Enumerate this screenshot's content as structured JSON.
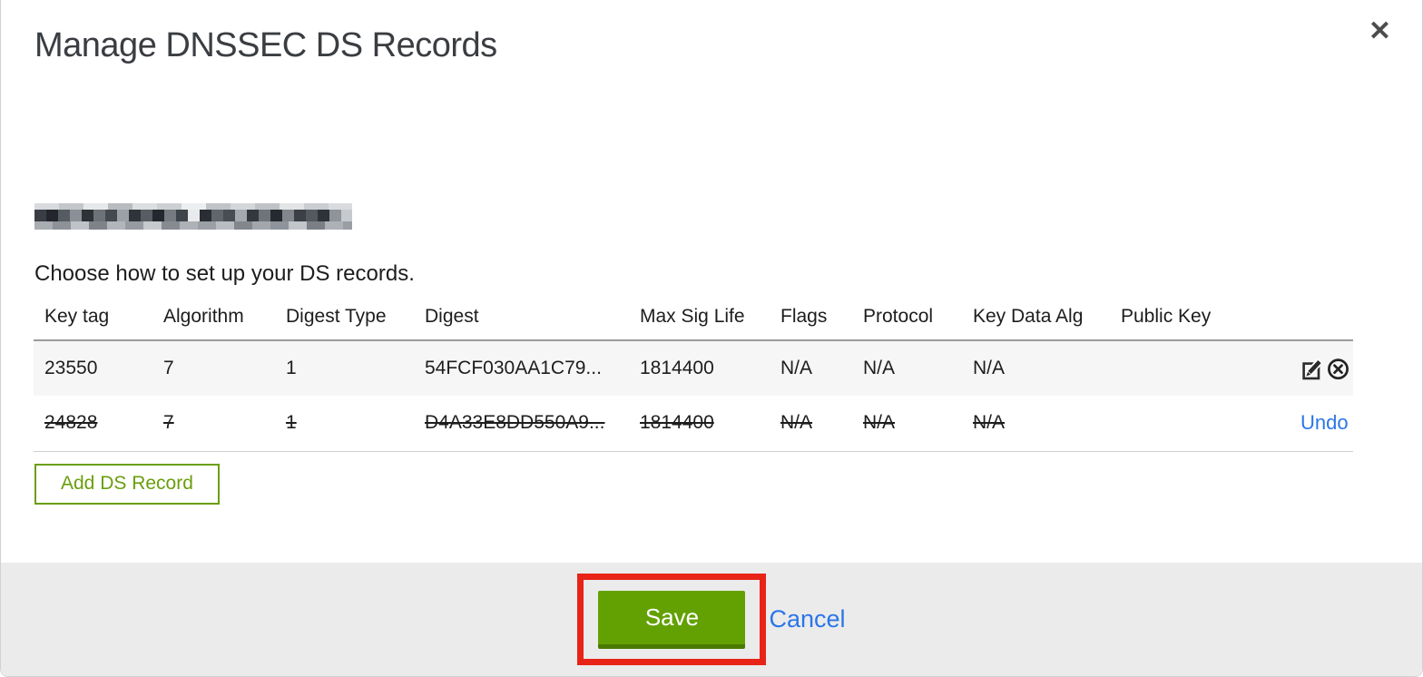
{
  "modal": {
    "title": "Manage DNSSEC DS Records",
    "close_glyph": "✕"
  },
  "instruction": "Choose how to set up your DS records.",
  "table": {
    "headers": [
      "Key tag",
      "Algorithm",
      "Digest Type",
      "Digest",
      "Max Sig Life",
      "Flags",
      "Protocol",
      "Key Data Alg",
      "Public Key"
    ],
    "rows": [
      {
        "key_tag": "23550",
        "algorithm": "7",
        "digest_type": "1",
        "digest": "54FCF030AA1C79...",
        "max_sig_life": "1814400",
        "flags": "N/A",
        "protocol": "N/A",
        "key_data_alg": "N/A",
        "public_key": "",
        "deleted": false,
        "action_icons": [
          "edit-icon",
          "remove-icon"
        ]
      },
      {
        "key_tag": "24828",
        "algorithm": "7",
        "digest_type": "1",
        "digest": "D4A33E8DD550A9...",
        "max_sig_life": "1814400",
        "flags": "N/A",
        "protocol": "N/A",
        "key_data_alg": "N/A",
        "public_key": "",
        "deleted": true,
        "undo_label": "Undo"
      }
    ]
  },
  "add_button_label": "Add DS Record",
  "footer": {
    "save_label": "Save",
    "cancel_label": "Cancel"
  },
  "colors": {
    "save_button_green": "#63a103",
    "save_button_border_green": "#4b7a02",
    "add_button_green": "#6b9e0e",
    "link_blue": "#2b76e8",
    "annotation_red": "#e82418",
    "footer_background": "#ebebeb"
  }
}
